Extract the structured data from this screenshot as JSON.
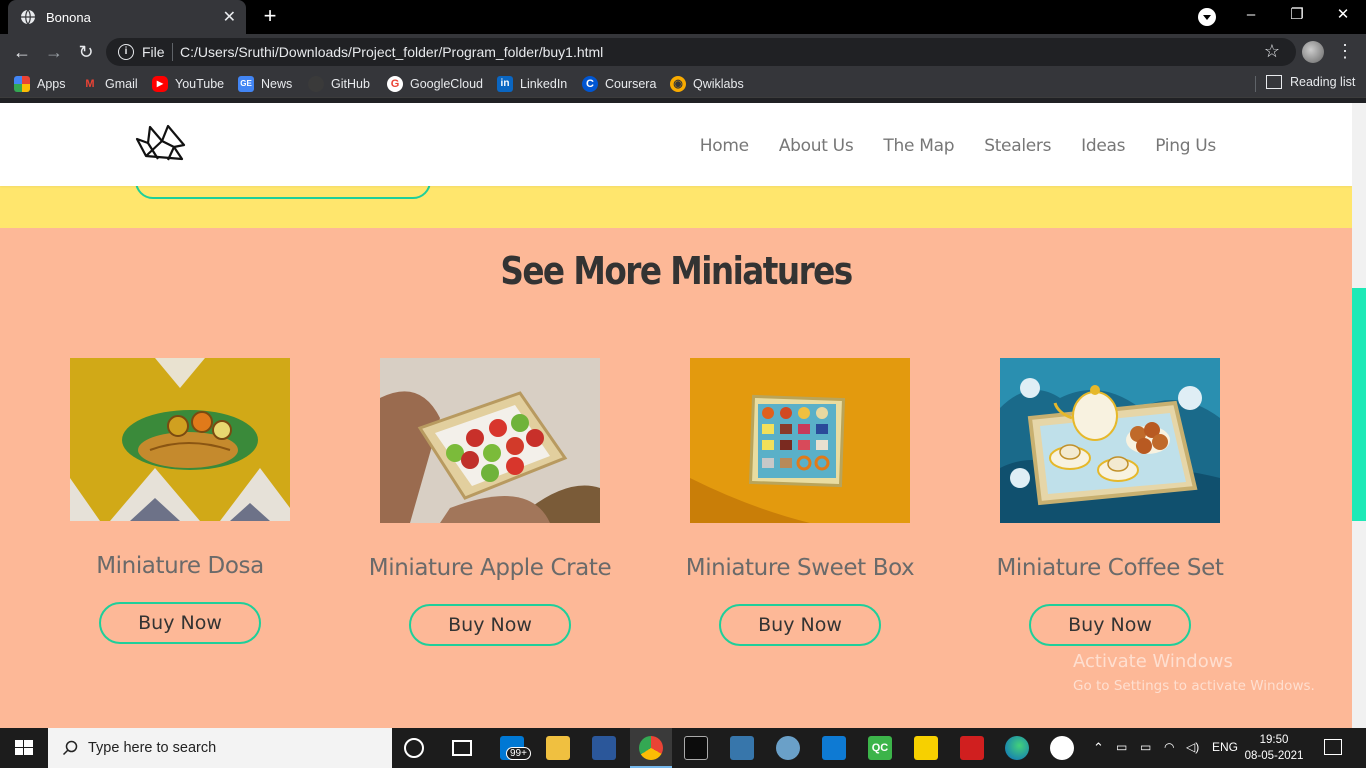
{
  "browser": {
    "tab_title": "Bonona",
    "scheme_label": "File",
    "url": "C:/Users/Sruthi/Downloads/Project_folder/Program_folder/buy1.html",
    "bookmarks": [
      {
        "label": "Apps",
        "icon": "apps-grid-icon",
        "color": "#4285f4"
      },
      {
        "label": "Gmail",
        "icon": "gmail-icon",
        "color": "#ea4335"
      },
      {
        "label": "YouTube",
        "icon": "youtube-icon",
        "color": "#ff0000"
      },
      {
        "label": "News",
        "icon": "google-news-icon",
        "color": "#4285f4"
      },
      {
        "label": "GitHub",
        "icon": "github-icon",
        "color": "#555555"
      },
      {
        "label": "GoogleCloud",
        "icon": "google-icon",
        "color": "#ffffff"
      },
      {
        "label": "LinkedIn",
        "icon": "linkedin-icon",
        "color": "#0a66c2"
      },
      {
        "label": "Coursera",
        "icon": "coursera-icon",
        "color": "#0056d2"
      },
      {
        "label": "Qwiklabs",
        "icon": "qwiklabs-icon",
        "color": "#f9ab00"
      }
    ],
    "reading_list": "Reading list"
  },
  "site": {
    "nav": [
      "Home",
      "About Us",
      "The Map",
      "Stealers",
      "Ideas",
      "Ping Us"
    ],
    "section_title": "See More Miniatures",
    "products": [
      {
        "name": "Miniature Dosa",
        "button": "Buy Now"
      },
      {
        "name": "Miniature Apple Crate",
        "button": "Buy Now"
      },
      {
        "name": "Miniature Sweet Box",
        "button": "Buy Now"
      },
      {
        "name": "Miniature Coffee Set",
        "button": "Buy Now"
      }
    ],
    "colors": {
      "accent": "#1ecf9a",
      "section_bg": "#fdb897",
      "band_bg": "#ffe66d"
    }
  },
  "watermark": {
    "line1": "Activate Windows",
    "line2": "Go to Settings to activate Windows."
  },
  "taskbar": {
    "search_placeholder": "Type here to search",
    "mail_badge": "99+",
    "language": "ENG",
    "time": "19:50",
    "date": "08-05-2021"
  }
}
